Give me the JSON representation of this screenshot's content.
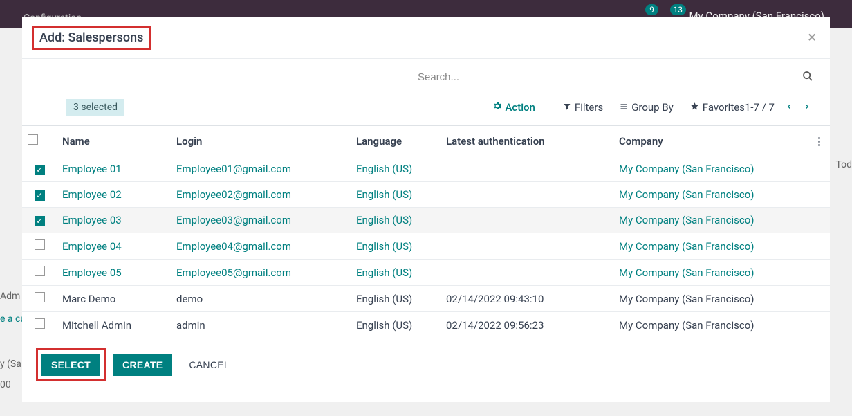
{
  "background": {
    "topleft": "Configuration",
    "topright": "My Company (San Francisco)",
    "badge1": "9",
    "badge2": "13",
    "left1": "Adm",
    "left2": "e a cu",
    "left3": "y (Sa",
    "left4": "00",
    "right1": "Tod"
  },
  "modal": {
    "title": "Add: Salespersons",
    "selected_badge": "3 selected",
    "action_label": "Action",
    "filters_label": "Filters",
    "groupby_label": "Group By",
    "favorites_label": "Favorites",
    "pager": "1-7 / 7",
    "search_placeholder": "Search..."
  },
  "columns": {
    "name": "Name",
    "login": "Login",
    "language": "Language",
    "auth": "Latest authentication",
    "company": "Company"
  },
  "rows": [
    {
      "checked": true,
      "name": "Employee 01",
      "login": "Employee01@gmail.com",
      "lang": "English (US)",
      "auth": "",
      "company": "My Company (San Francisco)",
      "link": true
    },
    {
      "checked": true,
      "name": "Employee 02",
      "login": "Employee02@gmail.com",
      "lang": "English (US)",
      "auth": "",
      "company": "My Company (San Francisco)",
      "link": true
    },
    {
      "checked": true,
      "name": "Employee 03",
      "login": "Employee03@gmail.com",
      "lang": "English (US)",
      "auth": "",
      "company": "My Company (San Francisco)",
      "link": true,
      "hover": true
    },
    {
      "checked": false,
      "name": "Employee 04",
      "login": "Employee04@gmail.com",
      "lang": "English (US)",
      "auth": "",
      "company": "My Company (San Francisco)",
      "link": true
    },
    {
      "checked": false,
      "name": "Employee 05",
      "login": "Employee05@gmail.com",
      "lang": "English (US)",
      "auth": "",
      "company": "My Company (San Francisco)",
      "link": true
    },
    {
      "checked": false,
      "name": "Marc Demo",
      "login": "demo",
      "lang": "English (US)",
      "auth": "02/14/2022 09:43:10",
      "company": "My Company (San Francisco)",
      "link": false
    },
    {
      "checked": false,
      "name": "Mitchell Admin",
      "login": "admin",
      "lang": "English (US)",
      "auth": "02/14/2022 09:56:23",
      "company": "My Company (San Francisco)",
      "link": false
    }
  ],
  "footer": {
    "select": "SELECT",
    "create": "CREATE",
    "cancel": "CANCEL"
  }
}
